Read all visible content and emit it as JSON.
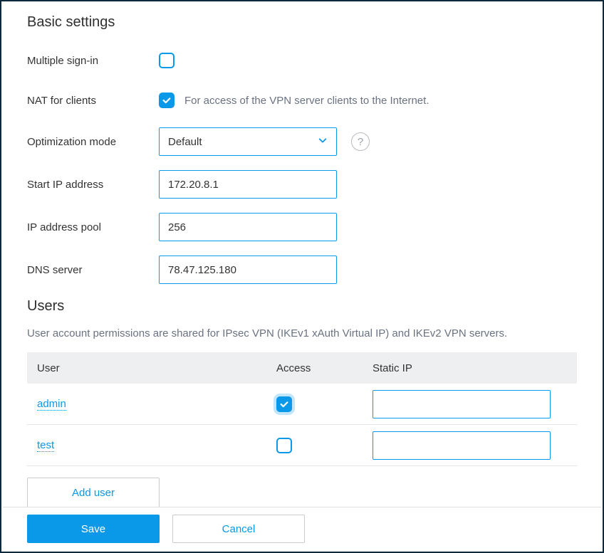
{
  "basic": {
    "title": "Basic settings",
    "rows": {
      "multiple_signin": {
        "label": "Multiple sign-in",
        "checked": false
      },
      "nat": {
        "label": "NAT for clients",
        "checked": true,
        "hint": "For access of the VPN server clients to the Internet."
      },
      "optimization": {
        "label": "Optimization mode",
        "value": "Default"
      },
      "start_ip": {
        "label": "Start IP address",
        "value": "172.20.8.1"
      },
      "pool": {
        "label": "IP address pool",
        "value": "256"
      },
      "dns": {
        "label": "DNS server",
        "value": "78.47.125.180"
      }
    }
  },
  "users": {
    "title": "Users",
    "description": "User account permissions are shared for IPsec VPN (IKEv1 xAuth Virtual IP) and IKEv2 VPN servers.",
    "columns": {
      "user": "User",
      "access": "Access",
      "static_ip": "Static IP"
    },
    "rows": [
      {
        "user": "admin",
        "access": true,
        "static_ip": ""
      },
      {
        "user": "test",
        "access": false,
        "static_ip": ""
      }
    ],
    "add_button": "Add user"
  },
  "footer": {
    "save": "Save",
    "cancel": "Cancel"
  }
}
